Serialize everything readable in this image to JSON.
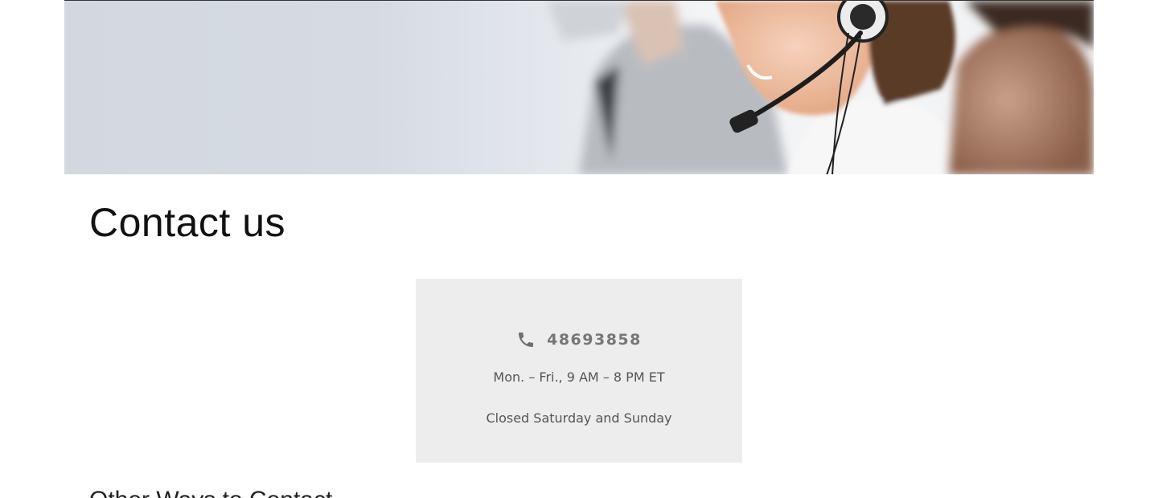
{
  "hero": {
    "image_alt": "customer support agent wearing headset"
  },
  "page_title": "Contact us",
  "contact_card": {
    "phone_icon": "phone-icon",
    "phone_number": "48693858",
    "hours": "Mon. – Fri., 9 AM – 8 PM ET",
    "closed": "Closed Saturday and Sunday",
    "background_color": "#ededed"
  },
  "next_section": {
    "heading": "Other Ways to Contact"
  }
}
